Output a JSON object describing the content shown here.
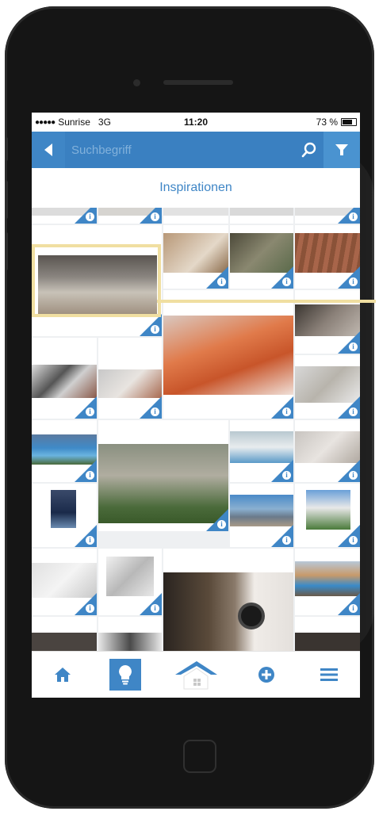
{
  "status_bar": {
    "signal_dots": "●●●●●",
    "carrier": "Sunrise",
    "network": "3G",
    "time": "11:20",
    "battery_text": "73 %",
    "battery_level": 0.73
  },
  "header": {
    "search_placeholder": "Suchbegriff",
    "back_icon": "chevron-left-icon",
    "search_icon": "search-icon",
    "filter_icon": "funnel-icon"
  },
  "page_title": "Inspirationen",
  "grid": {
    "info_symbol": "i",
    "tile_count": 28
  },
  "tab_bar": {
    "items": [
      {
        "icon": "home-icon",
        "active": false
      },
      {
        "icon": "lightbulb-icon",
        "active": true
      },
      {
        "icon": "house-roof-icon",
        "active": false
      },
      {
        "icon": "plus-circle-icon",
        "active": false
      },
      {
        "icon": "menu-icon",
        "active": false
      }
    ]
  },
  "colors": {
    "accent": "#3f86c6",
    "highlight": "#f0dfa1",
    "phone_body": "#151515"
  }
}
